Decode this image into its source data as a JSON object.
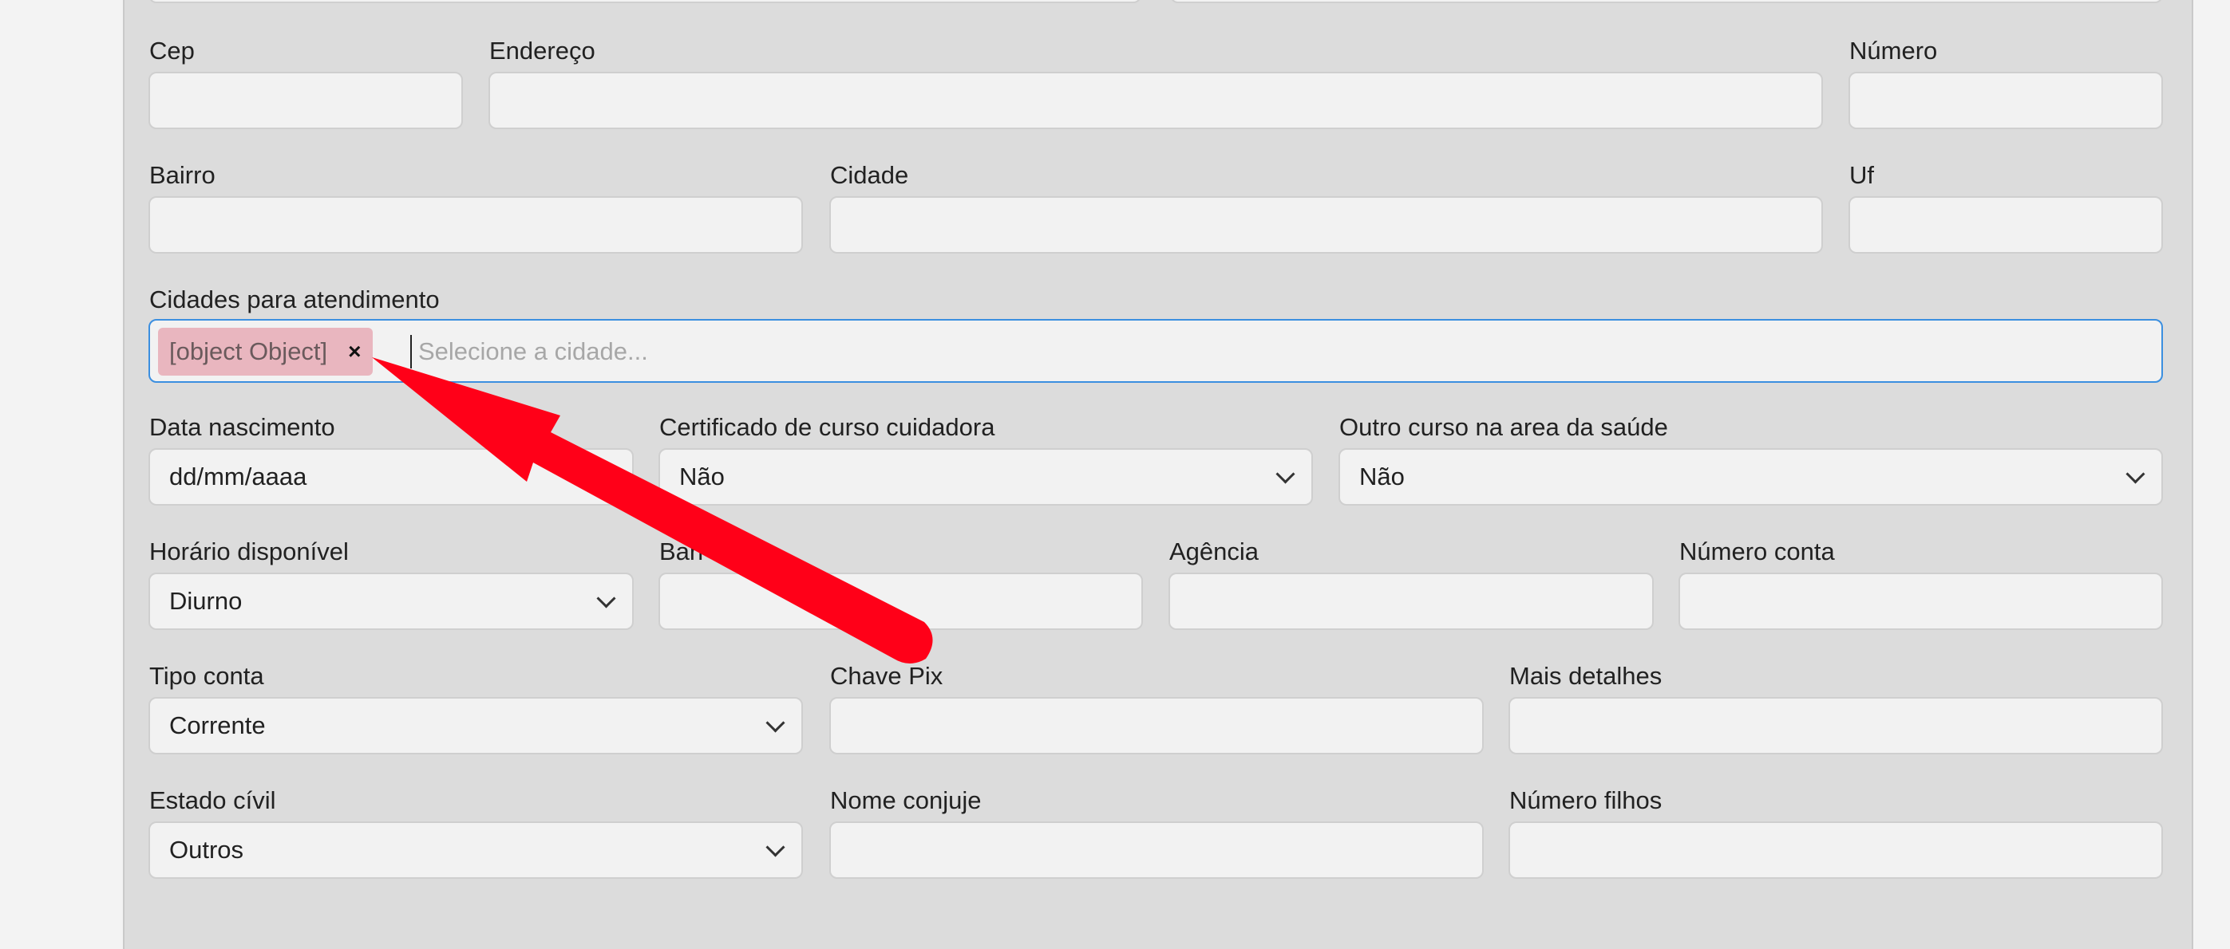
{
  "form": {
    "cep": {
      "label": "Cep",
      "value": ""
    },
    "endereco": {
      "label": "Endereço",
      "value": ""
    },
    "numero": {
      "label": "Número",
      "value": ""
    },
    "bairro": {
      "label": "Bairro",
      "value": ""
    },
    "cidade": {
      "label": "Cidade",
      "value": ""
    },
    "uf": {
      "label": "Uf",
      "value": ""
    },
    "cidades_atendimento": {
      "label": "Cidades para atendimento",
      "selected_tag": "[object Object]",
      "remove_symbol": "×",
      "placeholder": "Selecione a cidade..."
    },
    "data_nascimento": {
      "label": "Data nascimento",
      "value": "dd/mm/aaaa"
    },
    "certificado_curso": {
      "label": "Certificado de curso cuidadora",
      "value": "Não"
    },
    "outro_curso": {
      "label": "Outro curso na area da saúde",
      "value": "Não"
    },
    "horario_disponivel": {
      "label": "Horário disponível",
      "value": "Diurno"
    },
    "banco": {
      "label": "Banco",
      "visible_label": "Ban",
      "value": ""
    },
    "agencia": {
      "label": "Agência",
      "value": ""
    },
    "numero_conta": {
      "label": "Número conta",
      "value": ""
    },
    "tipo_conta": {
      "label": "Tipo conta",
      "value": "Corrente"
    },
    "chave_pix": {
      "label": "Chave Pix",
      "value": ""
    },
    "mais_detalhes": {
      "label": "Mais detalhes",
      "value": ""
    },
    "estado_civil": {
      "label": "Estado cívil",
      "value": "Outros"
    },
    "nome_conjuje": {
      "label": "Nome conjuje",
      "value": ""
    },
    "numero_filhos": {
      "label": "Número filhos",
      "value": ""
    }
  },
  "annotation": {
    "arrow_color": "#ff0018"
  },
  "colors": {
    "focus_border": "#3b8fe0",
    "tag_bg": "#e9b6bf",
    "panel_bg": "#dcdcdc"
  }
}
